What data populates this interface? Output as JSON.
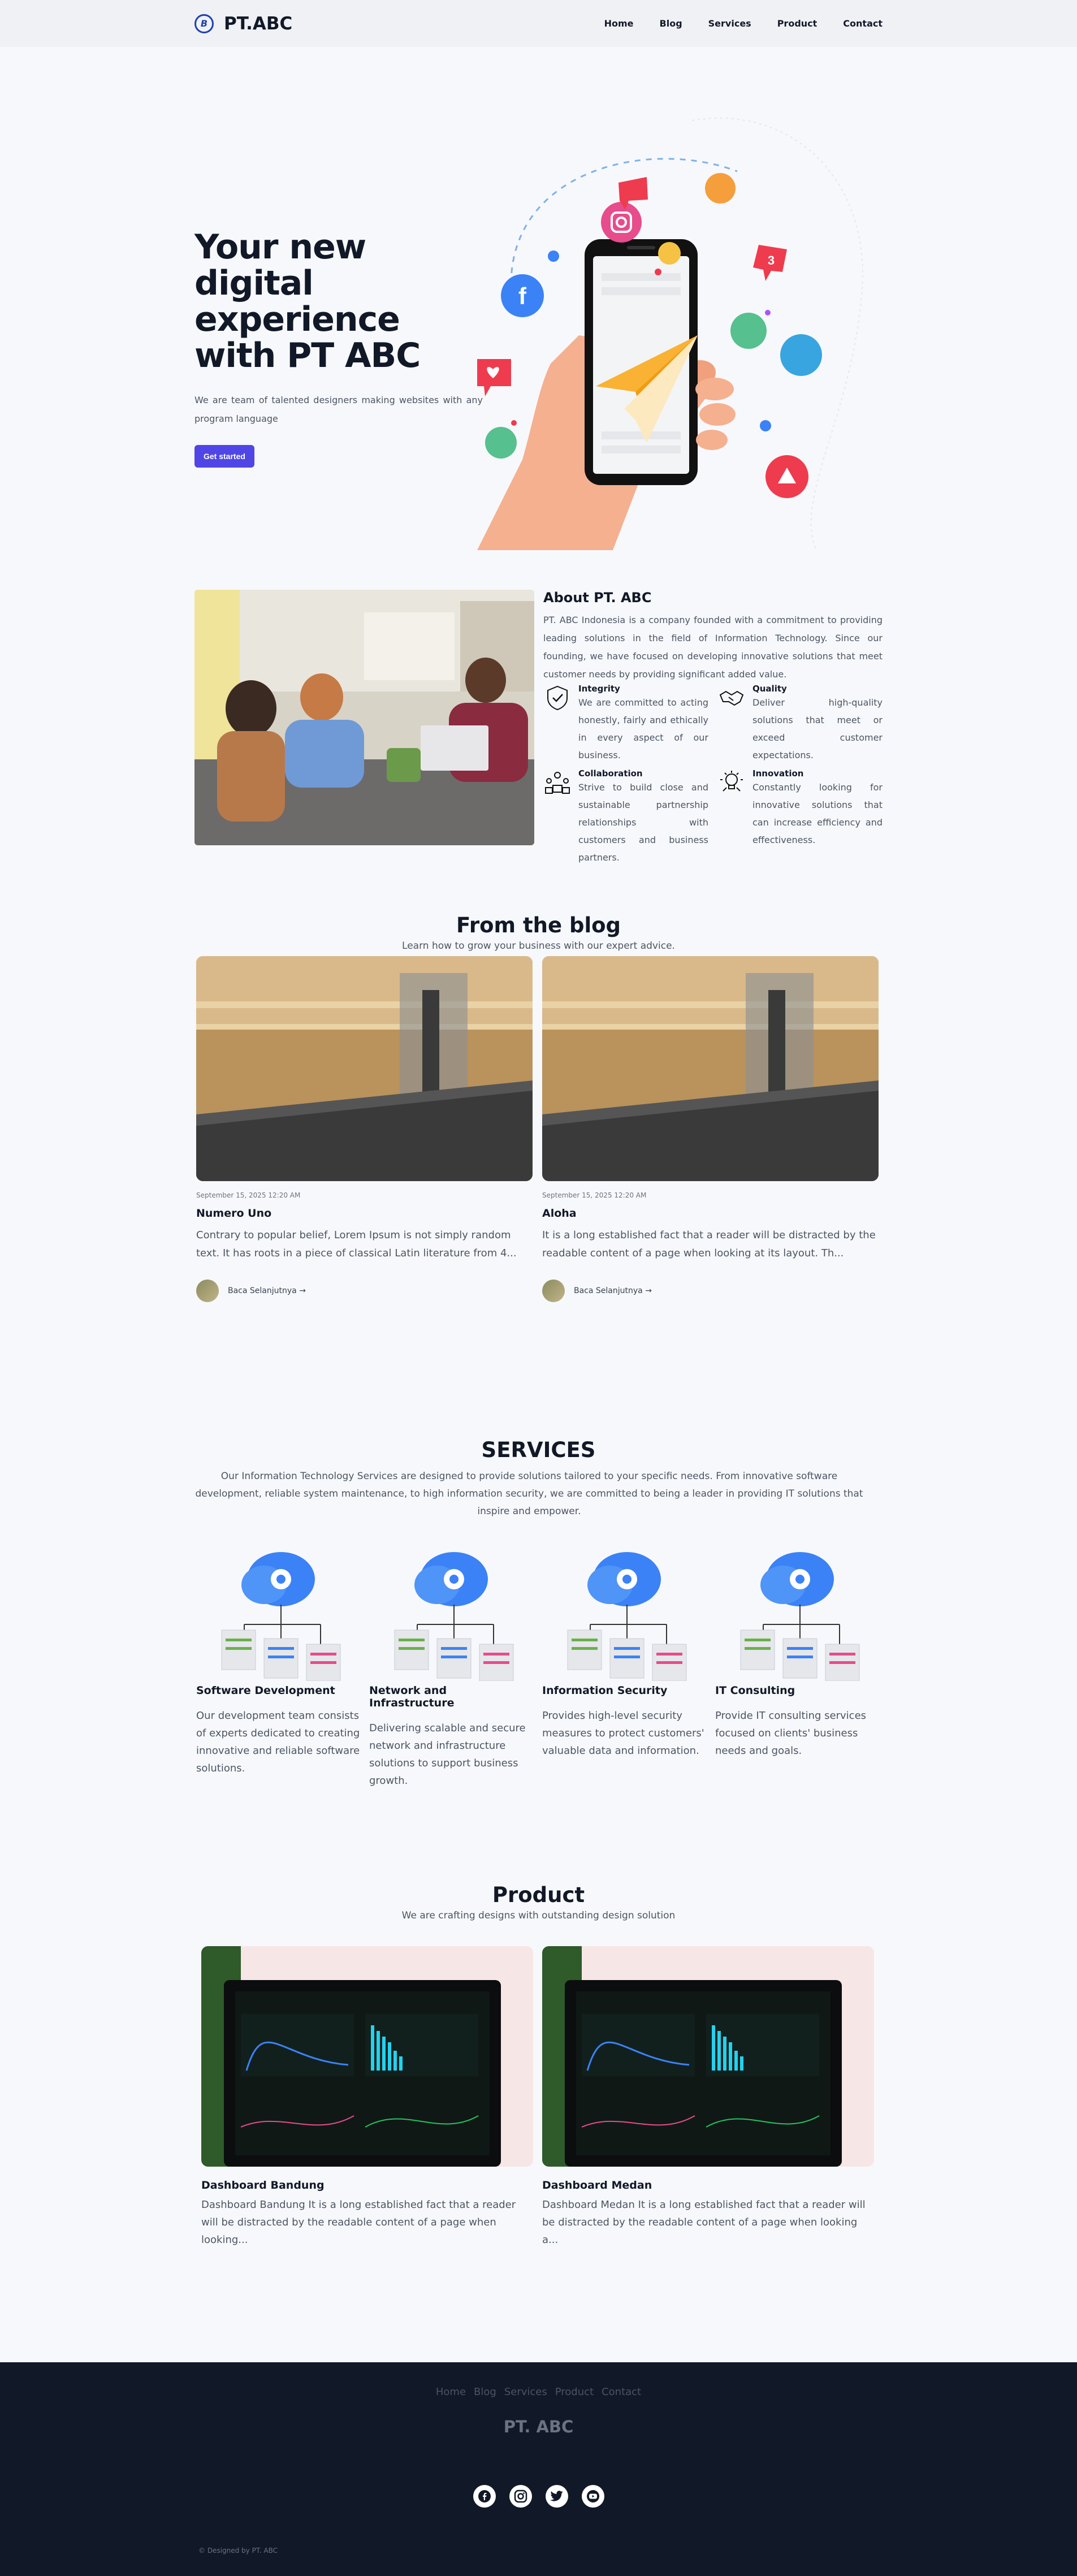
{
  "header": {
    "brand": "PT.ABC",
    "nav": [
      "Home",
      "Blog",
      "Services",
      "Product",
      "Contact"
    ]
  },
  "hero": {
    "title": "Your new digital experience with PT ABC",
    "subtitle": "We are team of talented designers making websites with any program language",
    "cta": "Get started"
  },
  "about": {
    "title": "About PT. ABC",
    "description": "PT. ABC Indonesia is a company founded with a commitment to providing leading solutions in the field of Information Technology. Since our founding, we have focused on developing innovative solutions that meet customer needs by providing significant added value.",
    "values": [
      {
        "title": "Integrity",
        "desc": "We are committed to acting honestly, fairly and ethically in every aspect of our business.",
        "icon": "shield-check-icon"
      },
      {
        "title": "Quality",
        "desc": "Deliver high-quality solutions that meet or exceed customer expectations.",
        "icon": "handshake-icon"
      },
      {
        "title": "Collaboration",
        "desc": "Strive to build close and sustainable partnership relationships with customers and business partners.",
        "icon": "team-icon"
      },
      {
        "title": "Innovation",
        "desc": "Constantly looking for innovative solutions that can increase efficiency and effectiveness.",
        "icon": "lightbulb-icon"
      }
    ]
  },
  "blog": {
    "title": "From the blog",
    "subtitle": "Learn how to grow your business with our expert advice.",
    "posts": [
      {
        "date": "September 15, 2025 12:20 AM",
        "title": "Numero Uno",
        "excerpt": "Contrary to popular belief, Lorem Ipsum is not simply random text. It has roots in a piece of classical Latin literature from 4...",
        "link": "Baca Selanjutnya →"
      },
      {
        "date": "September 15, 2025 12:20 AM",
        "title": "Aloha",
        "excerpt": "It is a long established fact that a reader will be distracted by the readable content of a page when looking at its layout. Th...",
        "link": "Baca Selanjutnya →"
      }
    ]
  },
  "services": {
    "title": "SERVICES",
    "subtitle": "Our Information Technology Services are designed to provide solutions tailored to your specific needs. From innovative software development, reliable system maintenance, to high information security, we are committed to being a leader in providing IT solutions that inspire and empower.",
    "items": [
      {
        "title": "Software Development",
        "desc": "Our development team consists of experts dedicated to creating innovative and reliable software solutions."
      },
      {
        "title": "Network and Infrastructure",
        "desc": "Delivering scalable and secure network and infrastructure solutions to support business growth."
      },
      {
        "title": "Information Security",
        "desc": "Provides high-level security measures to protect customers' valuable data and information."
      },
      {
        "title": "IT Consulting",
        "desc": "Provide IT consulting services focused on clients' business needs and goals."
      }
    ]
  },
  "product": {
    "title": "Product",
    "subtitle": "We are crafting designs with outstanding design solution",
    "items": [
      {
        "title": "Dashboard Bandung",
        "desc": "Dashboard Bandung It is a long established fact that a reader will be distracted by the readable content of a page when looking..."
      },
      {
        "title": "Dashboard Medan",
        "desc": "Dashboard Medan It is a long established fact that a reader will be distracted by the readable content of a page when looking a..."
      }
    ]
  },
  "footer": {
    "nav": [
      "Home",
      "Blog",
      "Services",
      "Product",
      "Contact"
    ],
    "brand": "PT. ABC",
    "socials": [
      "facebook-icon",
      "instagram-icon",
      "twitter-icon",
      "youtube-icon"
    ],
    "copyright": "© Designed by PT. ABC"
  },
  "colors": {
    "accent": "#4f46e5",
    "footer_bg": "#111827",
    "page_bg": "#f7f8fb"
  }
}
